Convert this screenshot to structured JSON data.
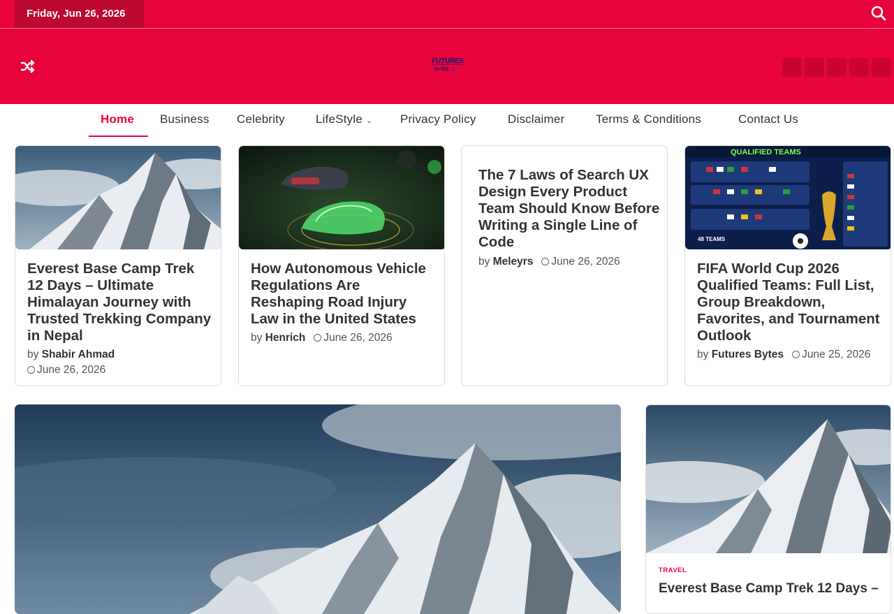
{
  "topbar": {
    "date": "Friday, Jun 26, 2026",
    "search_icon": "search-icon"
  },
  "header": {
    "shuffle_icon": "shuffle-icon",
    "logo": "FUTURES BYTES",
    "social_icons": [
      "facebook-icon",
      "twitter-icon",
      "instagram-icon",
      "pinterest-icon",
      "linkedin-icon"
    ]
  },
  "nav": {
    "items": [
      {
        "label": "Home",
        "active": true
      },
      {
        "label": "Business"
      },
      {
        "label": "Celebrity"
      },
      {
        "label": "LifeStyle",
        "has_dropdown": true
      },
      {
        "label": "Privacy Policy"
      },
      {
        "label": "Disclaimer"
      },
      {
        "label": "Terms & Conditions"
      },
      {
        "label": "Contact Us"
      }
    ]
  },
  "cards": [
    {
      "title": "Everest Base Camp Trek 12 Days – Ultimate Himalayan Journey with Trusted Trekking Company in Nepal",
      "by": "by",
      "author": "Shabir Ahmad",
      "date": "June 26, 2026",
      "image": "snowy-mountain-peak"
    },
    {
      "title": "How Autonomous Vehicle Regulations Are Reshaping Road Injury Law in the United States",
      "by": "by",
      "author": "Henrich",
      "date": "June 26, 2026",
      "image": "autonomous-cars"
    },
    {
      "title": "The 7 Laws of Search UX Design Every Product Team Should Know Before Writing a Single Line of Code",
      "by": "by",
      "author": "Meleyrs",
      "date": "June 26, 2026"
    },
    {
      "title": "FIFA World Cup 2026 Qualified Teams: Full List, Group Breakdown, Favorites, and Tournament Outlook",
      "by": "by",
      "author": "Futures Bytes",
      "date": "June 25, 2026",
      "image": "qualified-teams-graphic",
      "image_caption": "QUALIFIED TEAMS",
      "image_subcaption": "48 TEAMS"
    }
  ],
  "feature": {
    "image": "snowy-mountain-peak"
  },
  "side_card": {
    "category": "TRAVEL",
    "title": "Everest Base Camp Trek 12 Days –",
    "image": "snowy-mountain-peak"
  },
  "colors": {
    "brand": "#e8033b",
    "brand_dark": "#bd0830"
  }
}
